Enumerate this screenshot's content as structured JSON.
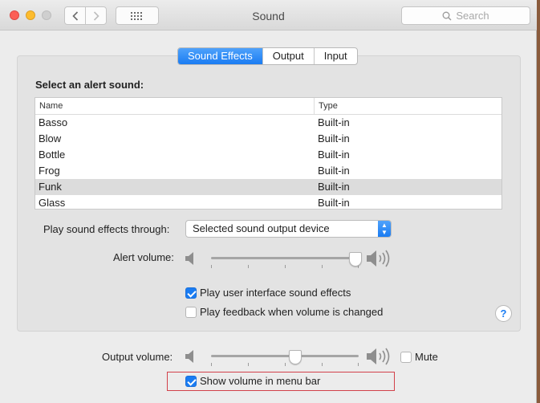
{
  "window": {
    "title": "Sound",
    "search_placeholder": "Search"
  },
  "tabs": [
    {
      "label": "Sound Effects",
      "active": true
    },
    {
      "label": "Output",
      "active": false
    },
    {
      "label": "Input",
      "active": false
    }
  ],
  "sound_effects": {
    "heading": "Select an alert sound:",
    "columns": [
      "Name",
      "Type"
    ],
    "rows": [
      {
        "name": "Basso",
        "type": "Built-in"
      },
      {
        "name": "Blow",
        "type": "Built-in"
      },
      {
        "name": "Bottle",
        "type": "Built-in"
      },
      {
        "name": "Frog",
        "type": "Built-in"
      },
      {
        "name": "Funk",
        "type": "Built-in"
      },
      {
        "name": "Glass",
        "type": "Built-in"
      }
    ],
    "selected_row": 4,
    "play_through_label": "Play sound effects through:",
    "play_through_value": "Selected sound output device",
    "alert_volume_label": "Alert volume:",
    "alert_volume_level": 0.98,
    "ui_sounds_label": "Play user interface sound effects",
    "ui_sounds_checked": true,
    "feedback_label": "Play feedback when volume is changed",
    "feedback_checked": false,
    "help_label": "?"
  },
  "output": {
    "volume_label": "Output volume:",
    "volume_level": 0.57,
    "mute_label": "Mute",
    "mute_checked": false,
    "menu_bar_label": "Show volume in menu bar",
    "menu_bar_checked": true
  },
  "colors": {
    "accent": "#1a7cf2",
    "highlight_box": "#d2414a"
  }
}
